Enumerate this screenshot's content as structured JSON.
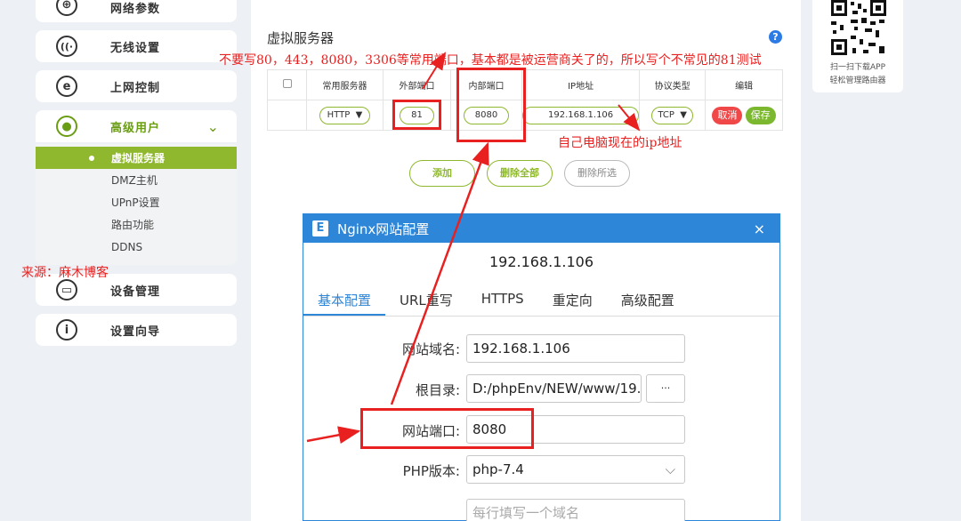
{
  "sidebar": {
    "items": [
      {
        "label": "网络参数",
        "icon": "globe-icon"
      },
      {
        "label": "无线设置",
        "icon": "wifi-icon"
      },
      {
        "label": "上网控制",
        "icon": "internet-icon"
      },
      {
        "label": "高级用户",
        "icon": "user-icon"
      },
      {
        "label": "设备管理",
        "icon": "router-icon"
      },
      {
        "label": "设置向导",
        "icon": "info-icon"
      }
    ],
    "submenu": [
      "虚拟服务器",
      "DMZ主机",
      "UPnP设置",
      "路由功能",
      "DDNS"
    ]
  },
  "main": {
    "title": "虚拟服务器",
    "help": "?",
    "table": {
      "headers": [
        "常用服务器",
        "外部端口",
        "内部端口",
        "IP地址",
        "协议类型",
        "编辑"
      ],
      "row": {
        "service": "HTTP",
        "ext_port": "81",
        "int_port": "8080",
        "ip": "192.168.1.106",
        "protocol": "TCP",
        "cancel": "取消",
        "save": "保存"
      }
    },
    "actions": {
      "add": "添加",
      "delete_all": "删除全部",
      "delete_selected": "删除所选"
    }
  },
  "qr": {
    "line1": "扫一扫下载APP",
    "line2": "轻松管理路由器"
  },
  "annotations": {
    "top_note": "不要写80，443，8080，3306等常用端口，基本都是被运营商关了的，所以写个不常见的81测试",
    "ip_note": "自己电脑现在的ip地址",
    "source": "来源：麻木博客"
  },
  "dialog": {
    "title": "Nginx网站配置",
    "logo": "E",
    "close": "×",
    "ip": "192.168.1.106",
    "tabs": [
      "基本配置",
      "URL重写",
      "HTTPS",
      "重定向",
      "高级配置"
    ],
    "fields": {
      "domain_label": "网站域名:",
      "domain_value": "192.168.1.106",
      "root_label": "根目录:",
      "root_value": "D:/phpEnv/NEW/www/19.",
      "browse": "···",
      "port_label": "网站端口:",
      "port_value": "8080",
      "php_label": "PHP版本:",
      "php_value": "php-7.4",
      "extra_placeholder": "每行填写一个域名"
    }
  },
  "colors": {
    "accent": "#8fb82f",
    "annotation": "#e8201f",
    "dialog": "#2d86d8"
  }
}
